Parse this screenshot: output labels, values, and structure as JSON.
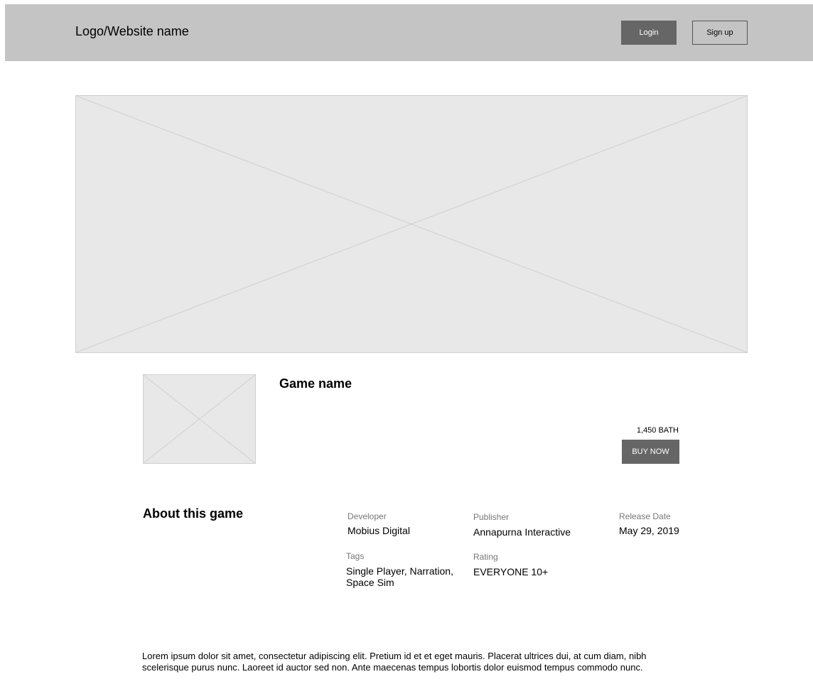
{
  "header": {
    "logo": "Logo/Website name",
    "login_label": "Login",
    "signup_label": "Sign up"
  },
  "game": {
    "name": "Game name",
    "price": "1,450 BATH",
    "buy_label": "BUY NOW"
  },
  "about": {
    "title": "About this game",
    "developer": {
      "label": "Developer",
      "value": "Mobius Digital"
    },
    "publisher": {
      "label": "Publisher",
      "value": "Annapurna Interactive"
    },
    "release": {
      "label": "Release Date",
      "value": "May 29, 2019"
    },
    "tags": {
      "label": "Tags",
      "value_line1": "Single Player, Narration,",
      "value_line2": "Space Sim"
    },
    "rating": {
      "label": "Rating",
      "value": "EVERYONE 10+"
    }
  },
  "description": "Lorem ipsum dolor sit amet, consectetur adipiscing elit. Pretium id et et eget mauris. Placerat ultrices dui, at cum diam, nibh scelerisque purus nunc. Laoreet id auctor sed non. Ante maecenas tempus lobortis dolor euismod tempus commodo nunc."
}
